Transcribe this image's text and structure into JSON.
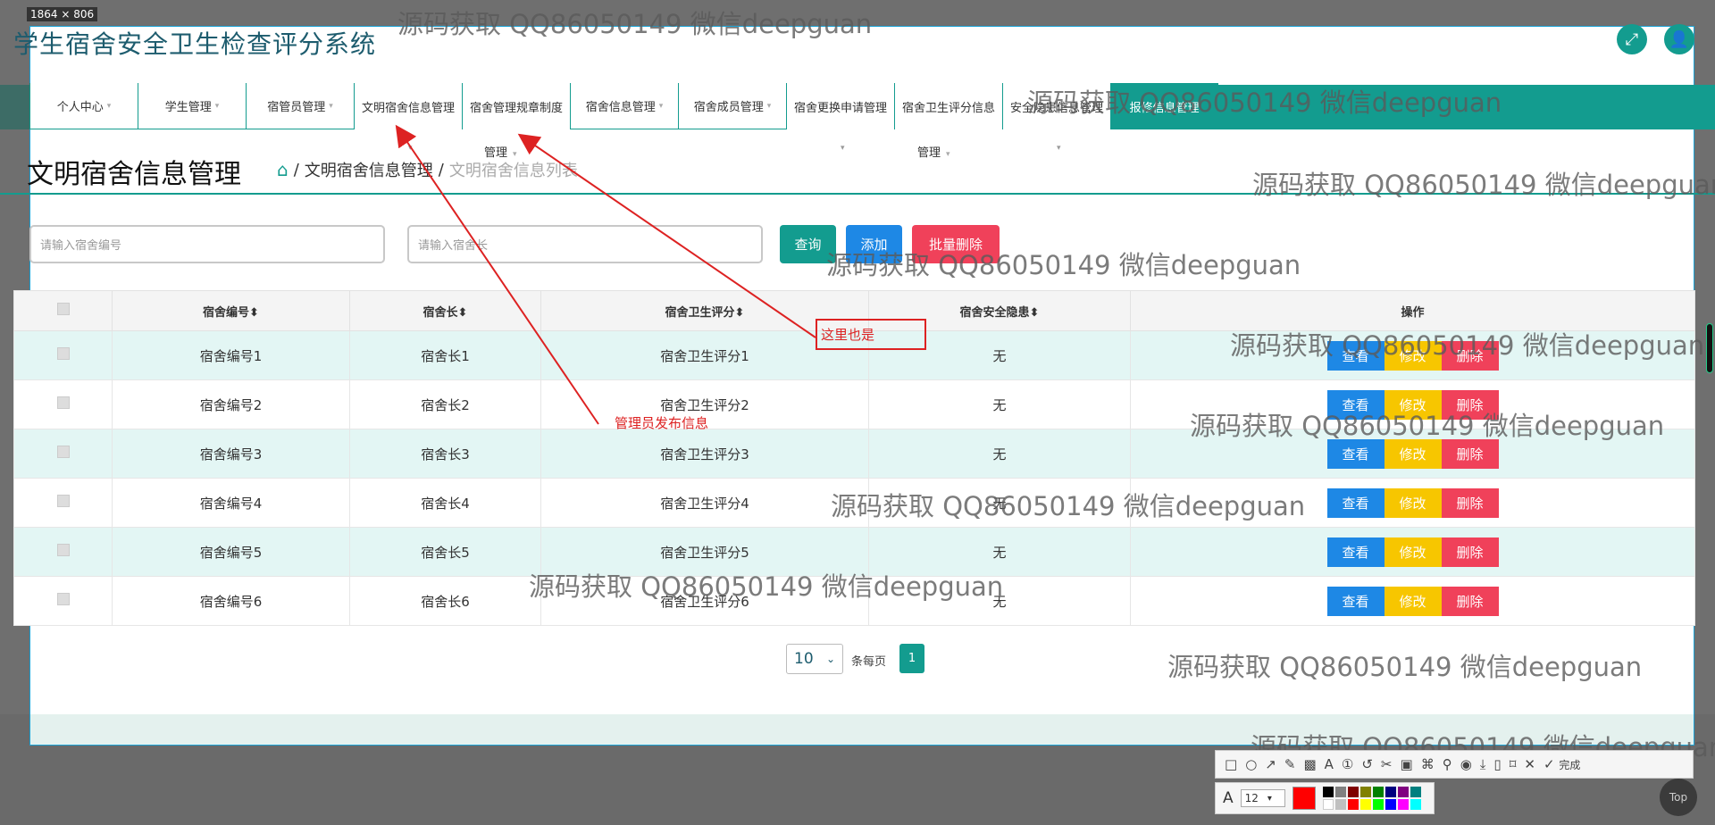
{
  "capture_size": "1864 × 806",
  "app_title": "学生宿舍安全卫生检查评分系统",
  "header_icons": {
    "expand": "expand-icon",
    "user": "user-icon"
  },
  "nav": [
    {
      "label": "个人中心",
      "caret": "▾"
    },
    {
      "label": "学生管理",
      "caret": "▾"
    },
    {
      "label": "宿管员管理",
      "caret": "▾"
    },
    {
      "label": "文明宿舍信息管理",
      "caret": ""
    },
    {
      "label": "宿舍管理规章制度",
      "caret": ""
    },
    {
      "label": "宿舍信息管理",
      "caret": "▾"
    },
    {
      "label": "宿舍成员管理",
      "caret": "▾"
    },
    {
      "label": "宿舍更换申请管理",
      "caret": ""
    },
    {
      "label": "宿舍卫生评分信息",
      "caret": ""
    },
    {
      "label": "安全隐患信息管理",
      "caret": ""
    },
    {
      "label": "报修信息管理",
      "caret": ""
    }
  ],
  "nav_sub": {
    "rules": "管理",
    "score": "管理"
  },
  "page_title": "文明宿舍信息管理",
  "breadcrumb": {
    "section": "文明宿舍信息管理",
    "current": "文明宿舍信息列表"
  },
  "search": {
    "dorm_no_placeholder": "请输入宿舍编号",
    "dorm_head_placeholder": "请输入宿舍长",
    "query": "查询",
    "add": "添加",
    "batch_delete": "批量删除"
  },
  "table": {
    "headers": [
      "宿舍编号",
      "宿舍长",
      "宿舍卫生评分",
      "宿舍安全隐患",
      "操作"
    ],
    "sort_icon": "⬍",
    "rows": [
      {
        "no": "宿舍编号1",
        "head": "宿舍长1",
        "score": "宿舍卫生评分1",
        "hazard": "无"
      },
      {
        "no": "宿舍编号2",
        "head": "宿舍长2",
        "score": "宿舍卫生评分2",
        "hazard": "无"
      },
      {
        "no": "宿舍编号3",
        "head": "宿舍长3",
        "score": "宿舍卫生评分3",
        "hazard": "无"
      },
      {
        "no": "宿舍编号4",
        "head": "宿舍长4",
        "score": "宿舍卫生评分4",
        "hazard": "无"
      },
      {
        "no": "宿舍编号5",
        "head": "宿舍长5",
        "score": "宿舍卫生评分5",
        "hazard": "无"
      },
      {
        "no": "宿舍编号6",
        "head": "宿舍长6",
        "score": "宿舍卫生评分6",
        "hazard": "无"
      }
    ],
    "actions": {
      "view": "查看",
      "edit": "修改",
      "delete": "删除"
    }
  },
  "pagination": {
    "page_size": "10",
    "per_page_label": "条每页",
    "current_page": "1"
  },
  "annotations": {
    "box_text": "这里也是",
    "arrow_text": "管理员发布信息"
  },
  "watermark": "源码获取 QQ86050149 微信deepguan",
  "toolbar": {
    "done": "完成",
    "font_size": "12",
    "top": "Top"
  },
  "colors": {
    "accent": "#139c8f",
    "view": "#1e88e5",
    "edit": "#f7c600",
    "delete": "#f0415a",
    "annotation": "#dd2222"
  }
}
